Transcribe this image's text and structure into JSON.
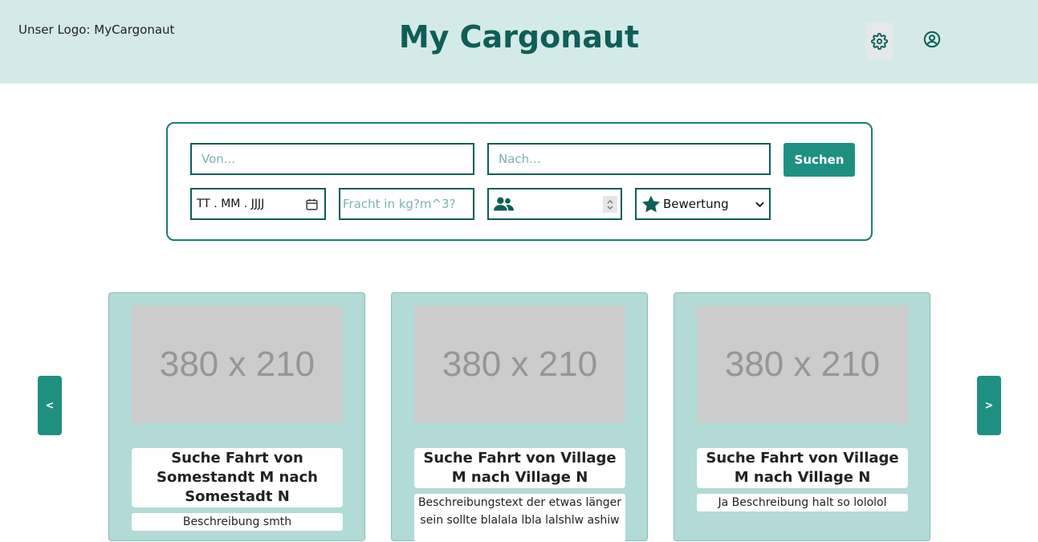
{
  "header": {
    "logo_text": "Unser Logo: MyCargonaut",
    "title": "My Cargonaut"
  },
  "search": {
    "from_placeholder": "Von...",
    "to_placeholder": "Nach...",
    "search_button": "Suchen",
    "date_placeholder": "TT . MM . JJJJ",
    "freight_placeholder": "Fracht in kg?m^3?",
    "persons_value": "",
    "rating_selected": "Bewertung"
  },
  "carousel": {
    "prev_label": "<",
    "next_label": ">",
    "cards": [
      {
        "image_placeholder": "380 x 210",
        "title": "Suche Fahrt von Somestandt M nach Somestadt N",
        "description": "Beschreibung smth"
      },
      {
        "image_placeholder": "380 x 210",
        "title": "Suche Fahrt von Village M nach Village N",
        "description": "Beschreibungstext der etwas länger sein sollte blalala lbla lalshlw ashiw"
      },
      {
        "image_placeholder": "380 x 210",
        "title": "Suche Fahrt von Village M nach Village N",
        "description": "Ja Beschreibung halt so lololol"
      }
    ]
  },
  "colors": {
    "header_bg": "#d4eae8",
    "brand": "#0e5e57",
    "accent": "#1f8f82",
    "card_bg": "#b2dad7"
  },
  "icons": {
    "settings": "gear-icon",
    "account": "user-circle-icon",
    "calendar": "calendar-icon",
    "persons": "users-icon",
    "rating": "star-icon",
    "dropdown": "chevron-down-icon"
  }
}
